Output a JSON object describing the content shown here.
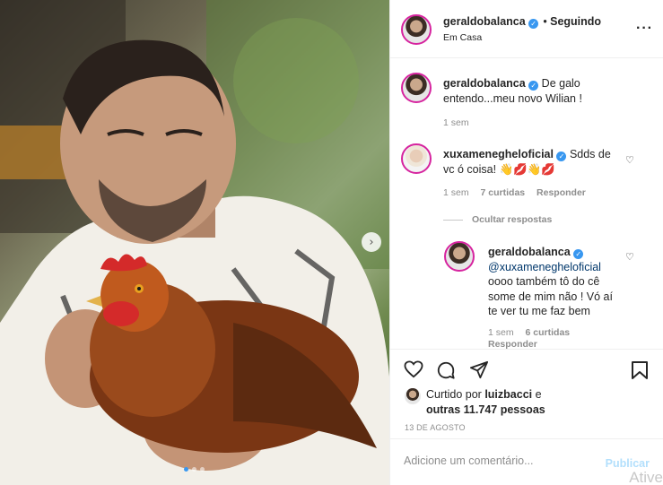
{
  "post": {
    "carousel_dots": 3,
    "active_dot": 0,
    "next_icon": "chevron-right-icon"
  },
  "header": {
    "username": "geraldobalanca",
    "separator": "•",
    "follow_status": "Seguindo",
    "location": "Em Casa",
    "more_icon": "more-horizontal-icon"
  },
  "caption": {
    "username": "geraldobalanca",
    "text": "De galo entendo...meu novo Wilian !",
    "time": "1 sem"
  },
  "comments": [
    {
      "username": "xuxamenegheloficial",
      "text": "Sdds de vc ó coisa! 👋💋👋💋",
      "time": "1 sem",
      "likes": "7 curtidas",
      "reply_label": "Responder",
      "hide_replies_label": "Ocultar respostas",
      "replies": [
        {
          "username": "geraldobalanca",
          "mention": "@xuxamenegheloficial",
          "text": "oooo também tô do cê some de mim não ! Vó aí te ver tu me faz bem",
          "time": "1 sem",
          "likes": "6 curtidas",
          "reply_label": "Responder"
        }
      ]
    }
  ],
  "liked_by": {
    "prefix": "Curtido por",
    "username": "luizbacci",
    "conjunction": "e",
    "others": "outras 11.747 pessoas"
  },
  "date": "13 DE AGOSTO",
  "add_comment": {
    "placeholder": "Adicione um comentário...",
    "publish_label": "Publicar"
  },
  "watermark": "Ative",
  "colors": {
    "accent": "#3897f0",
    "publish_disabled": "#b2dffc",
    "muted": "#8e8e8e",
    "text": "#262626"
  }
}
